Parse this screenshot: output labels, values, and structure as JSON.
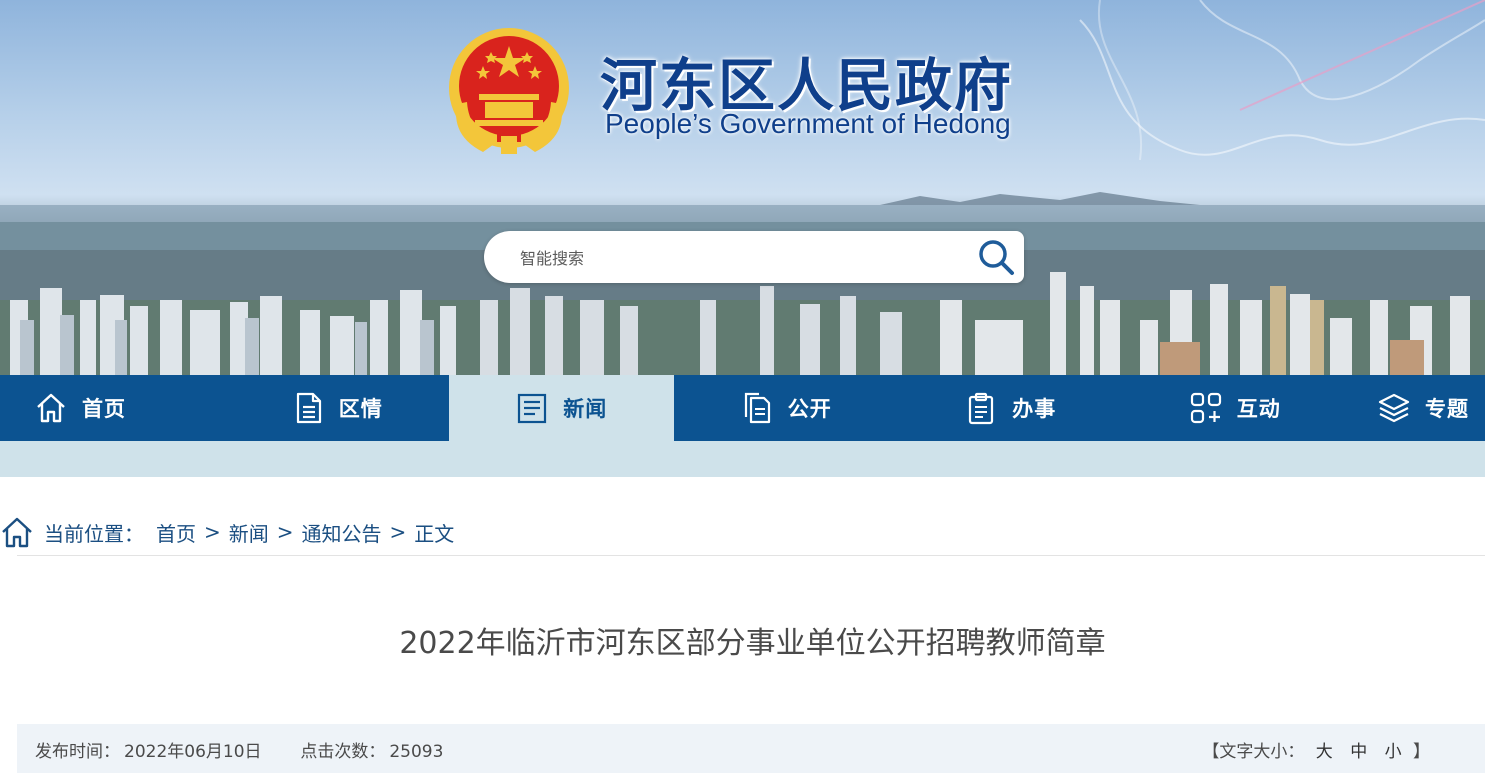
{
  "header": {
    "title": "河东区人民政府",
    "subtitle": "People’s Government of Hedong",
    "emblem_icon": "national-emblem-icon",
    "colors": {
      "brand_blue": "#0f3f8b",
      "emblem_red": "#d9231d",
      "emblem_gold": "#f3c63a"
    }
  },
  "search": {
    "placeholder": "智能搜索",
    "value": ""
  },
  "nav": {
    "items": [
      {
        "label": "首页",
        "icon": "home-icon"
      },
      {
        "label": "区情",
        "icon": "document-icon"
      },
      {
        "label": "新闻",
        "icon": "news-icon"
      },
      {
        "label": "公开",
        "icon": "files-icon"
      },
      {
        "label": "办事",
        "icon": "clipboard-icon"
      },
      {
        "label": "互动",
        "icon": "interact-icon"
      },
      {
        "label": "专题",
        "icon": "layers-icon"
      }
    ],
    "active": "新闻",
    "colors": {
      "bar": "#0c5391",
      "active_bg": "#cfe2ea"
    }
  },
  "breadcrumb": {
    "label": "当前位置：",
    "items": [
      "首页",
      "新闻",
      "通知公告",
      "正文"
    ],
    "separator": ">"
  },
  "article": {
    "title": "2022年临沂市河东区部分事业单位公开招聘教师简章",
    "publish_label": "发布时间：",
    "publish_date": "2022年06月10日",
    "clicks_label": "点击次数：",
    "clicks": "25093",
    "font_size_label": "【文字大小：",
    "font_size_options": [
      "大",
      "中",
      "小"
    ],
    "font_size_close": "】"
  }
}
